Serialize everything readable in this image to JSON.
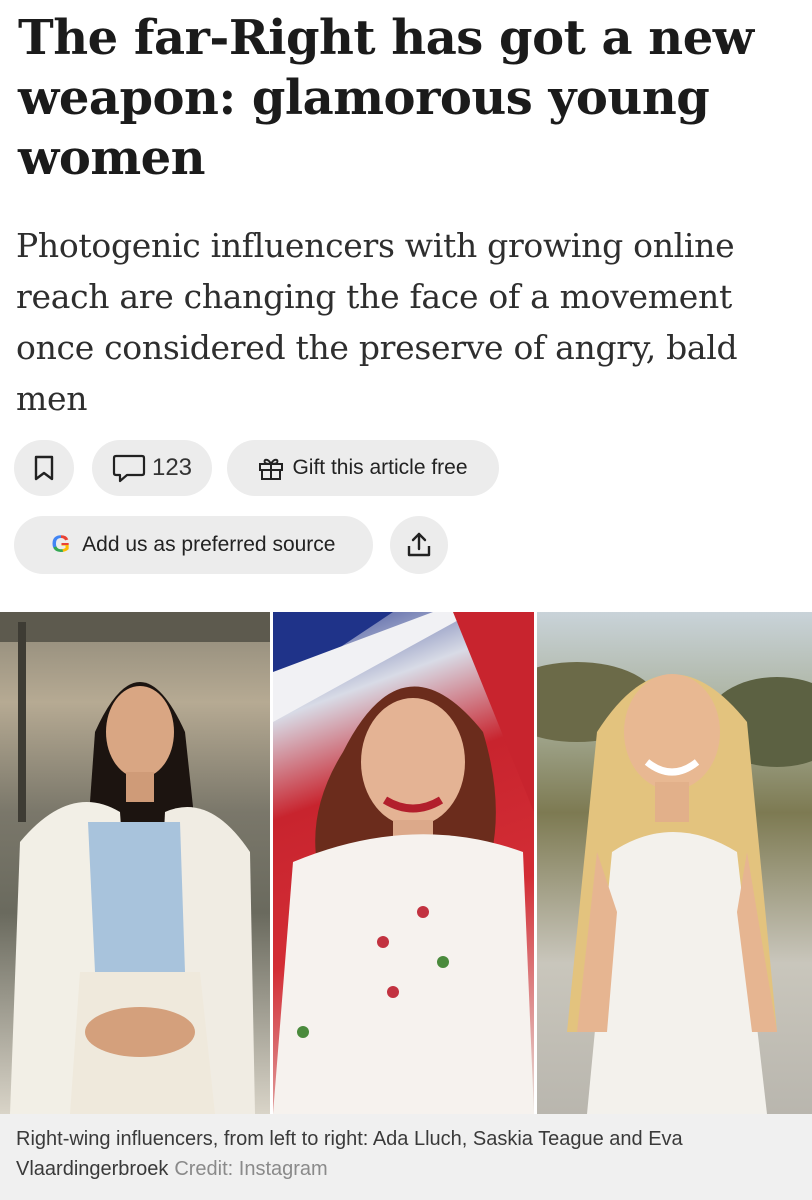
{
  "article": {
    "headline": "The far-Right has got a new weapon: glamorous young women",
    "standfirst": "Photogenic influencers with growing online reach are changing the face of a movement once considered the preserve of angry, bald men"
  },
  "actions": {
    "bookmark_icon": "bookmark-icon",
    "comment_icon": "comment-icon",
    "comment_count": "123",
    "gift_icon": "gift-icon",
    "gift_label": "Gift this article free",
    "google_logo": "G",
    "preferred_source_label": "Add us as preferred source",
    "share_icon": "share-icon"
  },
  "image": {
    "caption": "Right-wing influencers, from left to right: Ada Lluch, Saskia Teague and Eva Vlaardingerbroek",
    "credit": "Credit: Instagram"
  },
  "colors": {
    "pill_background": "#ececec",
    "headline_text": "#1b1b1b",
    "caption_background": "#f0f0f0",
    "credit_text": "#8a8a8a"
  }
}
